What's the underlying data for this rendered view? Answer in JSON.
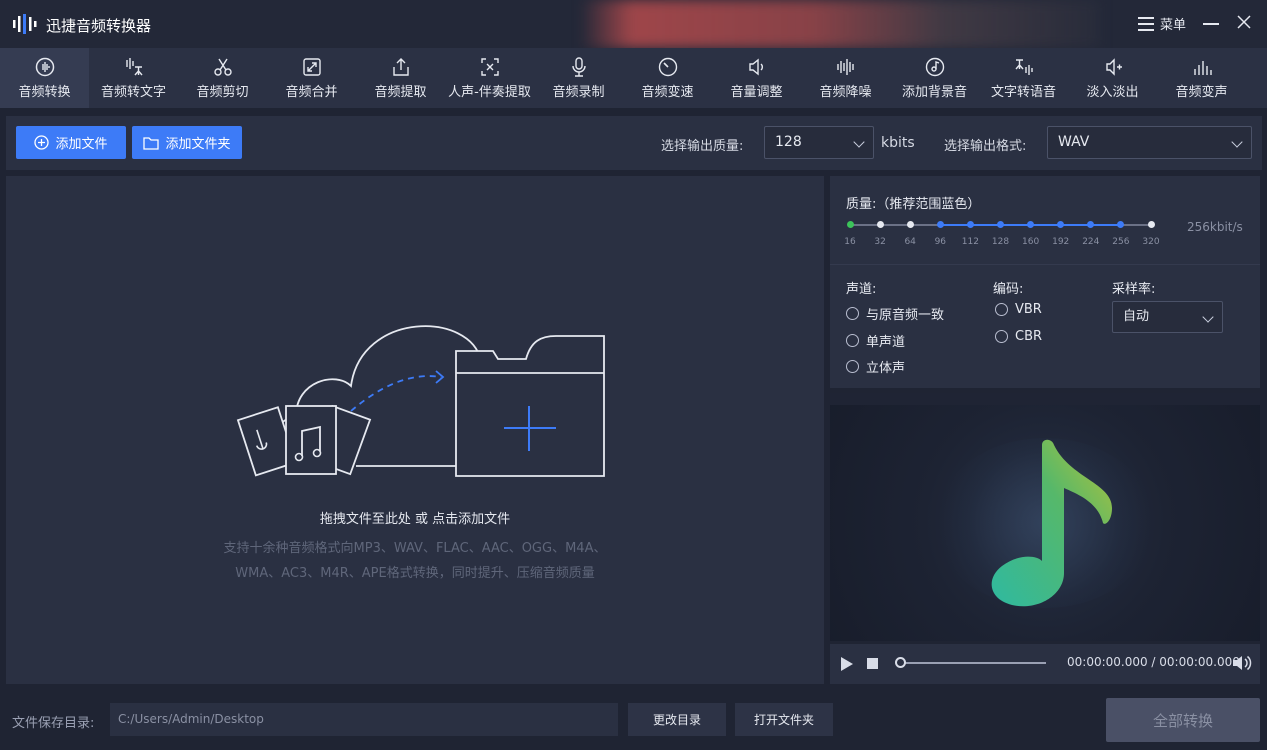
{
  "app": {
    "title": "迅捷音频转换器"
  },
  "titlebar": {
    "menu_label": "菜单"
  },
  "toolbar": {
    "items": [
      {
        "label": "音频转换",
        "icon": "audio-wave-icon",
        "active": true
      },
      {
        "label": "音频转文字",
        "icon": "speech-to-text-icon"
      },
      {
        "label": "音频剪切",
        "icon": "scissors-icon"
      },
      {
        "label": "音频合并",
        "icon": "merge-icon"
      },
      {
        "label": "音频提取",
        "icon": "extract-icon"
      },
      {
        "label": "人声-伴奏提取",
        "icon": "vocal-extract-icon"
      },
      {
        "label": "音频录制",
        "icon": "microphone-icon"
      },
      {
        "label": "音频变速",
        "icon": "speed-icon"
      },
      {
        "label": "音量调整",
        "icon": "volume-icon"
      },
      {
        "label": "音频降噪",
        "icon": "denoise-icon"
      },
      {
        "label": "添加背景音",
        "icon": "background-music-icon"
      },
      {
        "label": "文字转语音",
        "icon": "text-to-speech-icon"
      },
      {
        "label": "淡入淡出",
        "icon": "fade-icon"
      },
      {
        "label": "音频变声",
        "icon": "voice-change-icon"
      }
    ]
  },
  "actions": {
    "add_file": "添加文件",
    "add_folder": "添加文件夹",
    "quality_label": "选择输出质量:",
    "quality_value": "128",
    "quality_unit": "kbits",
    "format_label": "选择输出格式:",
    "format_value": "WAV"
  },
  "drop": {
    "hint": "拖拽文件至此处 或 点击添加文件",
    "desc_line1": "支持十余种音频格式向MP3、WAV、FLAC、AAC、OGG、M4A、",
    "desc_line2": "WMA、AC3、M4R、APE格式转换，同时提升、压缩音频质量"
  },
  "settings": {
    "quality_title": "质量:（推荐范围蓝色）",
    "quality_ticks": [
      "16",
      "32",
      "64",
      "96",
      "112",
      "128",
      "160",
      "192",
      "224",
      "256",
      "320"
    ],
    "quality_current": "256kbit/s",
    "channel_label": "声道:",
    "channel_options": [
      "与原音频一致",
      "单声道",
      "立体声"
    ],
    "encode_label": "编码:",
    "encode_options": [
      "VBR",
      "CBR"
    ],
    "rate_label": "采样率:",
    "rate_value": "自动"
  },
  "player": {
    "timecode": "00:00:00.000 / 00:00:00.000"
  },
  "bottom": {
    "save_label": "文件保存目录:",
    "path": "C:/Users/Admin/Desktop",
    "change_dir": "更改目录",
    "open_folder": "打开文件夹",
    "convert_all": "全部转换"
  },
  "colors": {
    "accent": "#3d7bf7",
    "background": "#1f2433",
    "panel": "#2a3042",
    "green_tick": "#3cc45a"
  }
}
